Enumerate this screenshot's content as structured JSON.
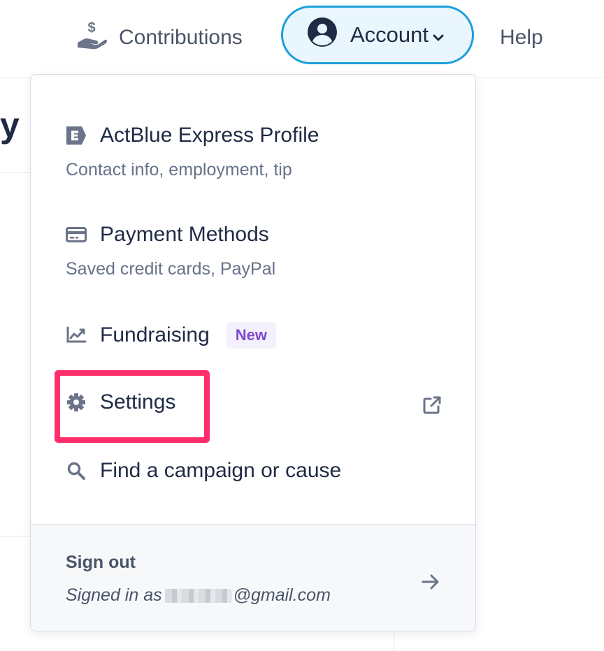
{
  "nav": {
    "contributions_label": "Contributions",
    "contributions_icon": "hand-dollar-icon",
    "account_label": "Account",
    "account_icon": "user-circle-icon",
    "help_label": "Help",
    "account_border_color": "#1b9fdc",
    "account_bg_color": "#e9f6fd"
  },
  "background": {
    "heading_fragment": "y"
  },
  "menu": {
    "items": [
      {
        "icon": "express-e-icon",
        "label": "ActBlue Express Profile",
        "sublabel": "Contact info, employment, tip"
      },
      {
        "icon": "credit-card-icon",
        "label": "Payment Methods",
        "sublabel": "Saved credit cards, PayPal"
      },
      {
        "icon": "chart-line-icon",
        "label": "Fundraising",
        "badge": "New"
      },
      {
        "icon": "gear-icon",
        "label": "Settings",
        "external_icon": "external-link-icon"
      },
      {
        "icon": "search-icon",
        "label": "Find a campaign or cause"
      }
    ],
    "footer": {
      "signout_label": "Sign out",
      "signed_in_prefix": "Signed in as",
      "email_suffix": "@gmail.com",
      "arrow_icon": "arrow-right-icon"
    }
  },
  "highlight_color": "#ff2e6b",
  "badge_color": "#7e4ad0"
}
